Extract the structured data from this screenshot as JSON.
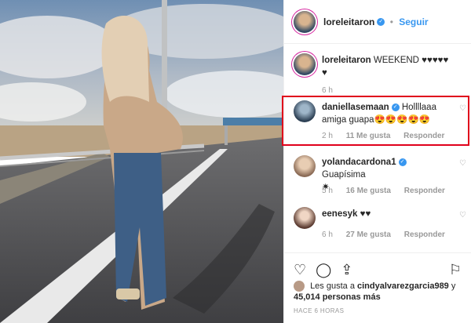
{
  "header": {
    "username": "loreleitaron",
    "follow_label": "Seguir",
    "dot": "•"
  },
  "caption": {
    "username": "loreleitaron",
    "text": "WEEKEND ♥♥♥♥♥",
    "text2": "♥",
    "time": "6 h"
  },
  "comments": [
    {
      "username": "daniellasemaan",
      "verified": true,
      "text": "Hollllaaa amiga guapa😍😍😍😍😍",
      "time": "2 h",
      "likes": "11 Me gusta",
      "reply": "Responder"
    },
    {
      "username": "yolandacardona1",
      "verified": true,
      "text": "Guapísima",
      "text2": "✷",
      "time": "5 h",
      "likes": "16 Me gusta",
      "reply": "Responder"
    },
    {
      "username": "eenesyk",
      "verified": false,
      "text": "♥♥",
      "time": "6 h",
      "likes": "27 Me gusta",
      "reply": "Responder"
    }
  ],
  "likes": {
    "prefix": "Les gusta a",
    "user": "cindyalvarezgarcia989",
    "suffix": "y",
    "count": "45,014 personas más"
  },
  "posted": "HACE 6 HORAS",
  "icons": [
    "heart-icon",
    "comment-icon",
    "share-icon",
    "bookmark-icon"
  ],
  "colors": {
    "accent": "#3897f0",
    "highlight": "#e0001b"
  }
}
